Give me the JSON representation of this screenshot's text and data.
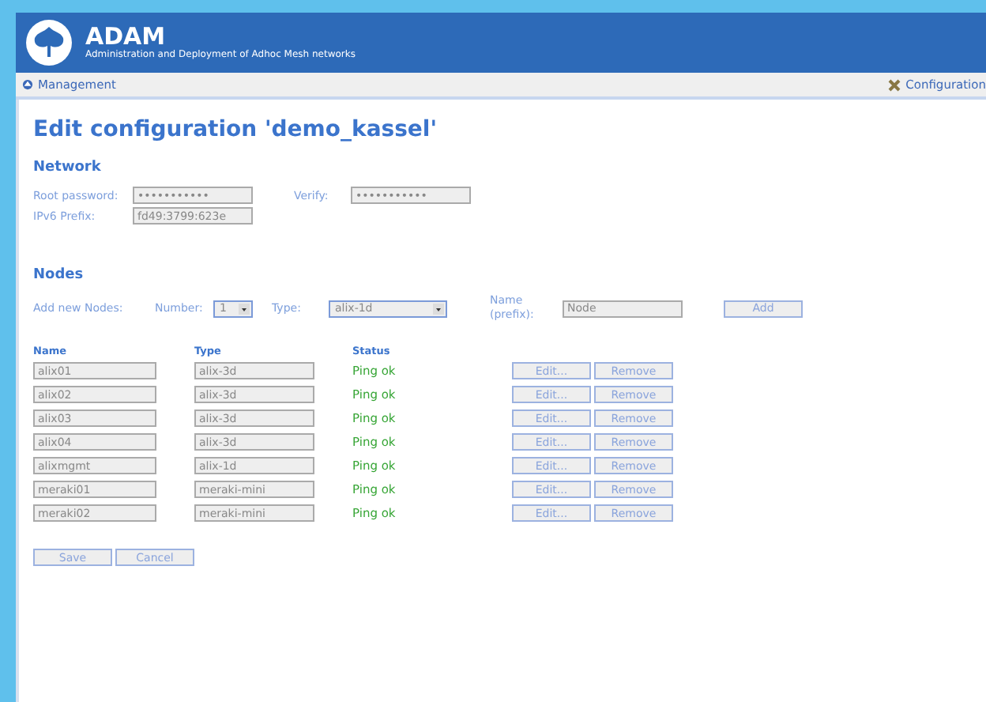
{
  "header": {
    "title": "ADAM",
    "subtitle": "Administration and Deployment of Adhoc Mesh networks"
  },
  "nav": {
    "left": "Management",
    "right": "Configuration"
  },
  "page_title": "Edit configuration 'demo_kassel'",
  "network": {
    "heading": "Network",
    "root_password_label": "Root password:",
    "root_password": "•••••••••••",
    "verify_label": "Verify:",
    "verify": "•••••••••••",
    "ipv6_label": "IPv6 Prefix:",
    "ipv6": "fd49:3799:623e"
  },
  "nodes": {
    "heading": "Nodes",
    "add_label": "Add new Nodes:",
    "number_label": "Number:",
    "number": "1",
    "type_label": "Type:",
    "type": "alix-1d",
    "name_label": "Name (prefix):",
    "name": "Node",
    "add_button": "Add",
    "columns": [
      "Name",
      "Type",
      "Status"
    ],
    "rows": [
      {
        "name": "alix01",
        "type": "alix-3d",
        "status": "Ping ok",
        "edit": "Edit...",
        "remove": "Remove"
      },
      {
        "name": "alix02",
        "type": "alix-3d",
        "status": "Ping ok",
        "edit": "Edit...",
        "remove": "Remove"
      },
      {
        "name": "alix03",
        "type": "alix-3d",
        "status": "Ping ok",
        "edit": "Edit...",
        "remove": "Remove"
      },
      {
        "name": "alix04",
        "type": "alix-3d",
        "status": "Ping ok",
        "edit": "Edit...",
        "remove": "Remove"
      },
      {
        "name": "alixmgmt",
        "type": "alix-1d",
        "status": "Ping ok",
        "edit": "Edit...",
        "remove": "Remove"
      },
      {
        "name": "meraki01",
        "type": "meraki-mini",
        "status": "Ping ok",
        "edit": "Edit...",
        "remove": "Remove"
      },
      {
        "name": "meraki02",
        "type": "meraki-mini",
        "status": "Ping ok",
        "edit": "Edit...",
        "remove": "Remove"
      }
    ]
  },
  "buttons": [
    "Save",
    "Cancel"
  ]
}
